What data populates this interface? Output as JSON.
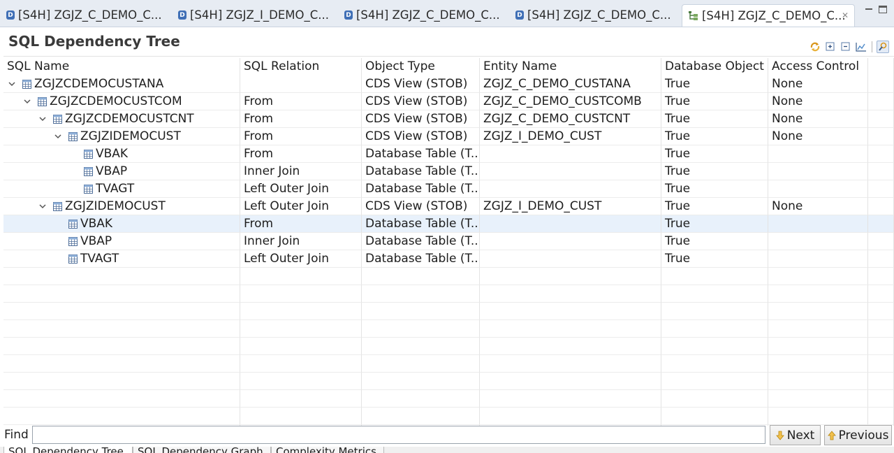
{
  "editor_tabs": [
    {
      "label": "[S4H] ZGJZ_C_DEMO_C...",
      "icon": "ddl-source-icon",
      "active": false
    },
    {
      "label": "[S4H] ZGJZ_I_DEMO_C...",
      "icon": "ddl-source-icon",
      "active": false
    },
    {
      "label": "[S4H] ZGJZ_C_DEMO_C...",
      "icon": "ddl-source-icon",
      "active": false
    },
    {
      "label": "[S4H] ZGJZ_C_DEMO_C...",
      "icon": "ddl-source-icon",
      "active": false
    },
    {
      "label": "[S4H] ZGJZ_C_DEMO_C...",
      "icon": "dependency-tree-icon",
      "active": true
    }
  ],
  "view": {
    "title": "SQL Dependency Tree",
    "toolbar": [
      "refresh-icon",
      "expand-all-icon",
      "collapse-all-icon",
      "chart-icon",
      "filter-icon"
    ]
  },
  "table": {
    "columns": [
      "SQL Name",
      "SQL Relation",
      "Object Type",
      "Entity Name",
      "Database Object",
      "Access Control"
    ],
    "rows": [
      {
        "level": 0,
        "expanded": true,
        "name": "ZGJZCDEMOCUSTANA",
        "relation": "",
        "type": "CDS View (STOB)",
        "entity": "ZGJZ_C_DEMO_CUSTANA",
        "dbobj": "True",
        "access": "None"
      },
      {
        "level": 1,
        "expanded": true,
        "name": "ZGJZCDEMOCUSTCOM",
        "relation": "From",
        "type": "CDS View (STOB)",
        "entity": "ZGJZ_C_DEMO_CUSTCOMB",
        "dbobj": "True",
        "access": "None"
      },
      {
        "level": 2,
        "expanded": true,
        "name": "ZGJZCDEMOCUSTCNT",
        "relation": "From",
        "type": "CDS View (STOB)",
        "entity": "ZGJZ_C_DEMO_CUSTCNT",
        "dbobj": "True",
        "access": "None"
      },
      {
        "level": 3,
        "expanded": true,
        "name": "ZGJZIDEMOCUST",
        "relation": "From",
        "type": "CDS View (STOB)",
        "entity": "ZGJZ_I_DEMO_CUST",
        "dbobj": "True",
        "access": "None"
      },
      {
        "level": 4,
        "expanded": null,
        "name": "VBAK",
        "relation": "From",
        "type": "Database Table (T...",
        "entity": "",
        "dbobj": "True",
        "access": ""
      },
      {
        "level": 4,
        "expanded": null,
        "name": "VBAP",
        "relation": "Inner Join",
        "type": "Database Table (T...",
        "entity": "",
        "dbobj": "True",
        "access": ""
      },
      {
        "level": 4,
        "expanded": null,
        "name": "TVAGT",
        "relation": "Left Outer Join",
        "type": "Database Table (T...",
        "entity": "",
        "dbobj": "True",
        "access": ""
      },
      {
        "level": 2,
        "expanded": true,
        "name": "ZGJZIDEMOCUST",
        "relation": "Left Outer Join",
        "type": "CDS View (STOB)",
        "entity": "ZGJZ_I_DEMO_CUST",
        "dbobj": "True",
        "access": "None"
      },
      {
        "level": 3,
        "expanded": null,
        "name": "VBAK",
        "relation": "From",
        "type": "Database Table (T...",
        "entity": "",
        "dbobj": "True",
        "access": "",
        "selected": true
      },
      {
        "level": 3,
        "expanded": null,
        "name": "VBAP",
        "relation": "Inner Join",
        "type": "Database Table (T...",
        "entity": "",
        "dbobj": "True",
        "access": ""
      },
      {
        "level": 3,
        "expanded": null,
        "name": "TVAGT",
        "relation": "Left Outer Join",
        "type": "Database Table (T...",
        "entity": "",
        "dbobj": "True",
        "access": ""
      }
    ]
  },
  "find": {
    "label": "Find",
    "value": "",
    "next_label": "Next",
    "previous_label": "Previous"
  },
  "bottom_tabs": [
    "SQL Dependency Tree",
    "SQL Dependency Graph",
    "Complexity Metrics"
  ],
  "colors": {
    "selection": "#e8f1fb",
    "ddl_icon": "#3f6fb6",
    "toolbar_accent": "#e3a82b"
  }
}
